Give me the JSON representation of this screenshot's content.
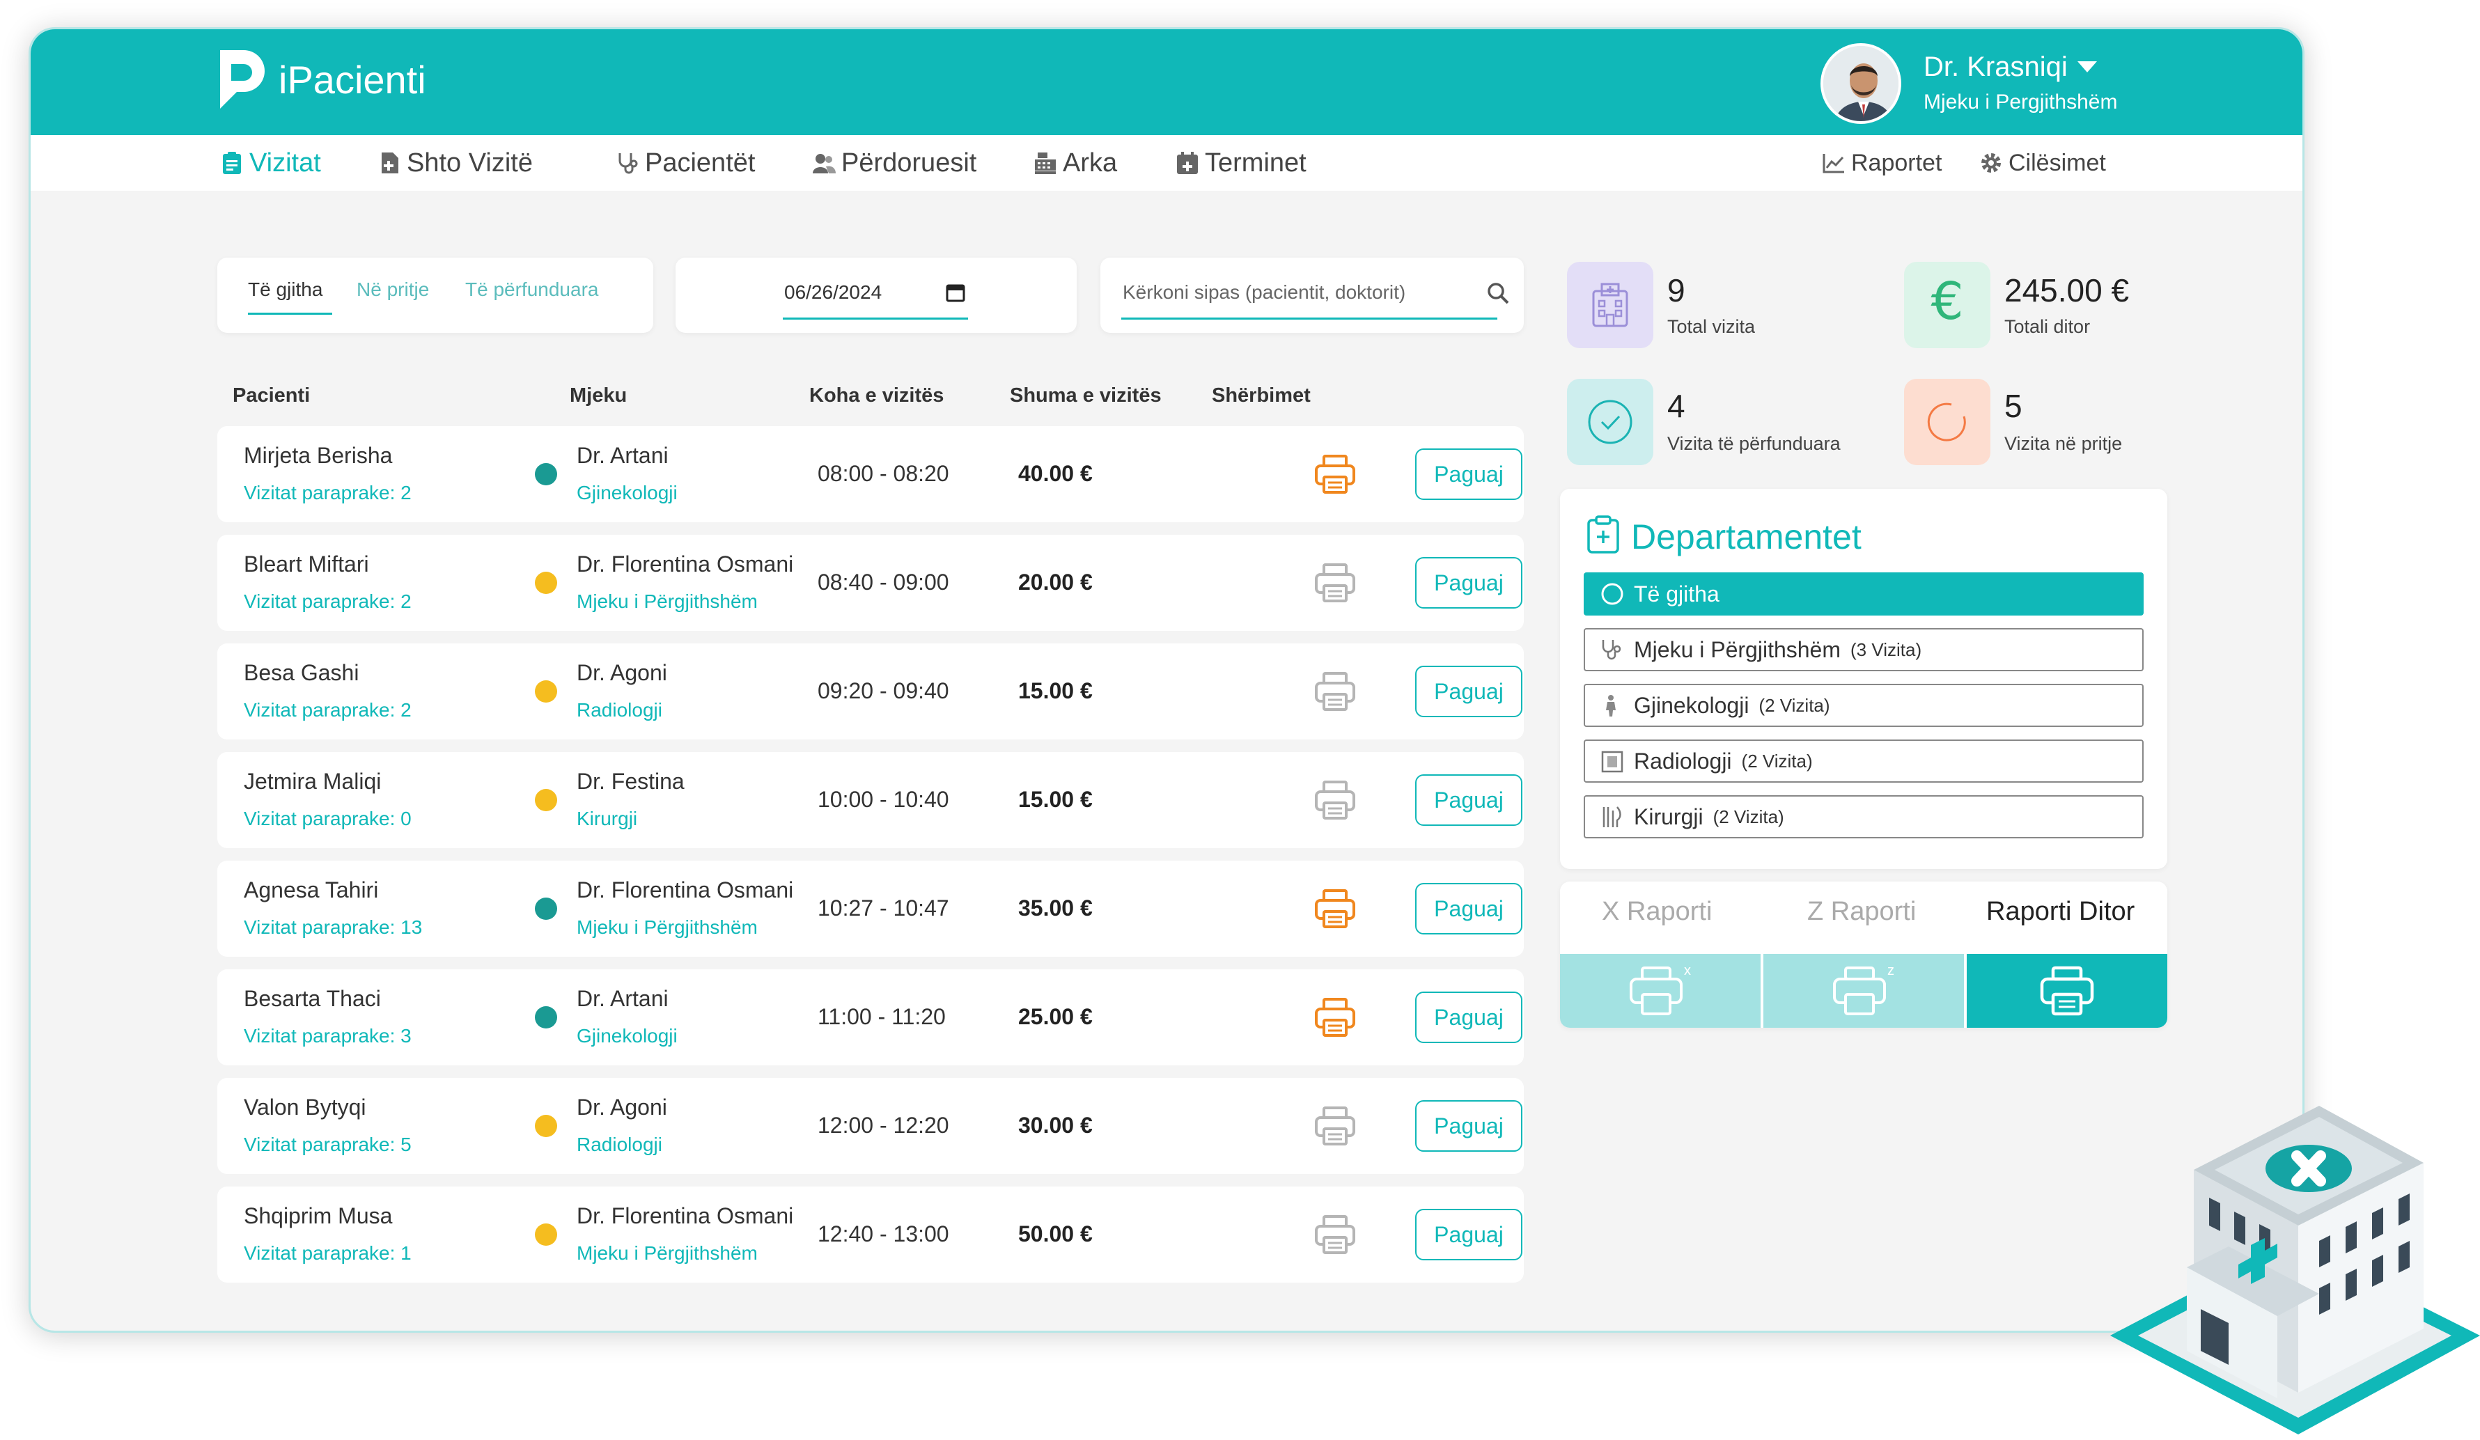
{
  "app": {
    "name": "iPacienti"
  },
  "user": {
    "name": "Dr. Krasniqi",
    "role": "Mjeku i Pergjithshëm"
  },
  "nav": [
    {
      "label": "Vizitat",
      "icon": "clipboard-icon",
      "active": true
    },
    {
      "label": "Shto Vizitë",
      "icon": "add-file-icon"
    },
    {
      "label": "Pacientët",
      "icon": "stethoscope-icon"
    },
    {
      "label": "Përdoruesit",
      "icon": "users-icon"
    },
    {
      "label": "Arka",
      "icon": "cash-register-icon"
    },
    {
      "label": "Terminet",
      "icon": "calendar-icon"
    }
  ],
  "nav_right": [
    {
      "label": "Raportet",
      "icon": "chart-icon"
    },
    {
      "label": "Cilësimet",
      "icon": "gear-icon"
    }
  ],
  "filters": {
    "tabs": [
      "Të gjitha",
      "Në pritje",
      "Të përfunduara"
    ],
    "active_tab": "Të gjitha",
    "date": "06/26/2024",
    "search_placeholder": "Kërkoni sipas (pacientit, doktorit)"
  },
  "table": {
    "headers": [
      "Pacienti",
      "Mjeku",
      "Koha e vizitës",
      "Shuma e vizitës",
      "Shërbimet"
    ],
    "pay_label": "Paguaj",
    "rows": [
      {
        "patient": "Mirjeta Berisha",
        "previous": "Vizitat paraprake: 2",
        "status": "done",
        "doctor": "Dr. Artani",
        "department": "Gjinekologji",
        "time": "08:00 - 08:20",
        "amount": "40.00 €",
        "printed": true
      },
      {
        "patient": "Bleart Miftari",
        "previous": "Vizitat paraprake: 2",
        "status": "pending",
        "doctor": "Dr. Florentina Osmani",
        "department": "Mjeku i Përgjithshëm",
        "time": "08:40 - 09:00",
        "amount": "20.00 €",
        "printed": false
      },
      {
        "patient": "Besa Gashi",
        "previous": "Vizitat paraprake: 2",
        "status": "pending",
        "doctor": "Dr. Agoni",
        "department": "Radiologji",
        "time": "09:20 - 09:40",
        "amount": "15.00 €",
        "printed": false
      },
      {
        "patient": "Jetmira Maliqi",
        "previous": "Vizitat paraprake: 0",
        "status": "pending",
        "doctor": "Dr. Festina",
        "department": "Kirurgji",
        "time": "10:00 - 10:40",
        "amount": "15.00 €",
        "printed": false
      },
      {
        "patient": "Agnesa Tahiri",
        "previous": "Vizitat paraprake: 13",
        "status": "done",
        "doctor": "Dr. Florentina Osmani",
        "department": "Mjeku i Përgjithshëm",
        "time": "10:27 - 10:47",
        "amount": "35.00 €",
        "printed": true
      },
      {
        "patient": "Besarta Thaci",
        "previous": "Vizitat paraprake: 3",
        "status": "done",
        "doctor": "Dr. Artani",
        "department": "Gjinekologji",
        "time": "11:00 - 11:20",
        "amount": "25.00 €",
        "printed": true
      },
      {
        "patient": "Valon Bytyqi",
        "previous": "Vizitat paraprake: 5",
        "status": "pending",
        "doctor": "Dr. Agoni",
        "department": "Radiologji",
        "time": "12:00 - 12:20",
        "amount": "30.00 €",
        "printed": false
      },
      {
        "patient": "Shqiprim Musa",
        "previous": "Vizitat paraprake: 1",
        "status": "pending",
        "doctor": "Dr. Florentina Osmani",
        "department": "Mjeku i Përgjithshëm",
        "time": "12:40 - 13:00",
        "amount": "50.00 €",
        "printed": false
      }
    ]
  },
  "stats": {
    "total_visits": {
      "value": "9",
      "label": "Total vizita"
    },
    "daily_total": {
      "value": "245.00 €",
      "label": "Totali ditor"
    },
    "completed": {
      "value": "4",
      "label": "Vizita të përfunduara"
    },
    "pending": {
      "value": "5",
      "label": "Vizita në pritje"
    }
  },
  "departments": {
    "title": "Departamentet",
    "items": [
      {
        "label": "Të gjitha",
        "count": "",
        "active": true
      },
      {
        "label": "Mjeku i Përgjithshëm",
        "count": "(3 Vizita)"
      },
      {
        "label": "Gjinekologji",
        "count": "(2 Vizita)"
      },
      {
        "label": "Radiologji",
        "count": "(2 Vizita)"
      },
      {
        "label": "Kirurgji",
        "count": "(2 Vizita)"
      }
    ]
  },
  "reports": {
    "tabs": [
      "X Raporti",
      "Z Raporti",
      "Raporti Ditor"
    ],
    "active": "Raporti Ditor",
    "x_mark": "x",
    "z_mark": "z"
  },
  "colors": {
    "brand": "#10b8b8",
    "done": "#1a9a93",
    "pending": "#f5bd1f",
    "print_active": "#f0871e",
    "print_idle": "#b5b5b5"
  }
}
